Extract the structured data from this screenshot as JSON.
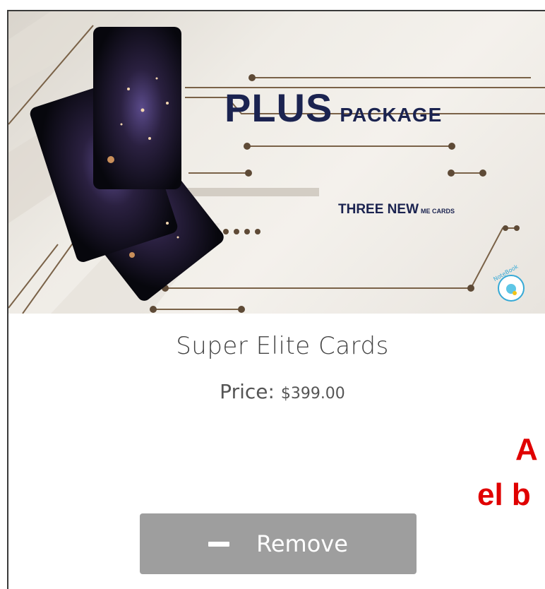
{
  "banner": {
    "headline_main": "PLUS",
    "headline_sub": "PACKAGE",
    "tagline_main": "THREE NEW",
    "tagline_small": "ME CARDS",
    "logo_text": "NoteBook"
  },
  "product": {
    "name": "Super Elite Cards",
    "price_label": "Price:",
    "price_value": "$399.00"
  },
  "side_text": {
    "line1": "A",
    "line2": "el b"
  },
  "remove_button": {
    "label": "Remove",
    "icon": "minus-icon"
  },
  "colors": {
    "headline": "#1b2350",
    "button_bg": "#9e9e9e",
    "side_text": "#e00000",
    "circuit": "#7a6248"
  }
}
